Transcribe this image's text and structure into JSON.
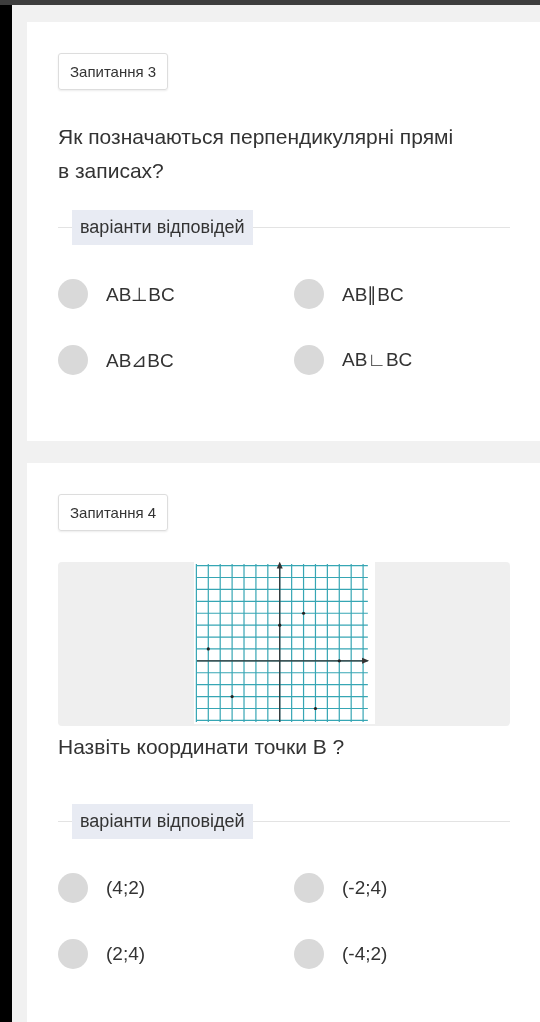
{
  "questions": [
    {
      "tag": "Запитання 3",
      "text": "Як позначаються перпендикулярні прямі в записах?",
      "options_label": "варіанти відповідей",
      "options": [
        {
          "label": "AB⊥BC",
          "selected": false
        },
        {
          "label": "AB∥BC",
          "selected": false
        },
        {
          "label": "AB⊿BC",
          "selected": false
        },
        {
          "label": "AB∟BC",
          "selected": false
        }
      ]
    },
    {
      "tag": "Запитання 4",
      "text": "Назвіть координати точки В ?",
      "options_label": "варіанти відповідей",
      "options": [
        {
          "label": "(4;2)",
          "selected": false
        },
        {
          "label": "(-2;4)",
          "selected": false
        },
        {
          "label": "(2;4)",
          "selected": false
        },
        {
          "label": "(-4;2)",
          "selected": false
        }
      ]
    }
  ]
}
